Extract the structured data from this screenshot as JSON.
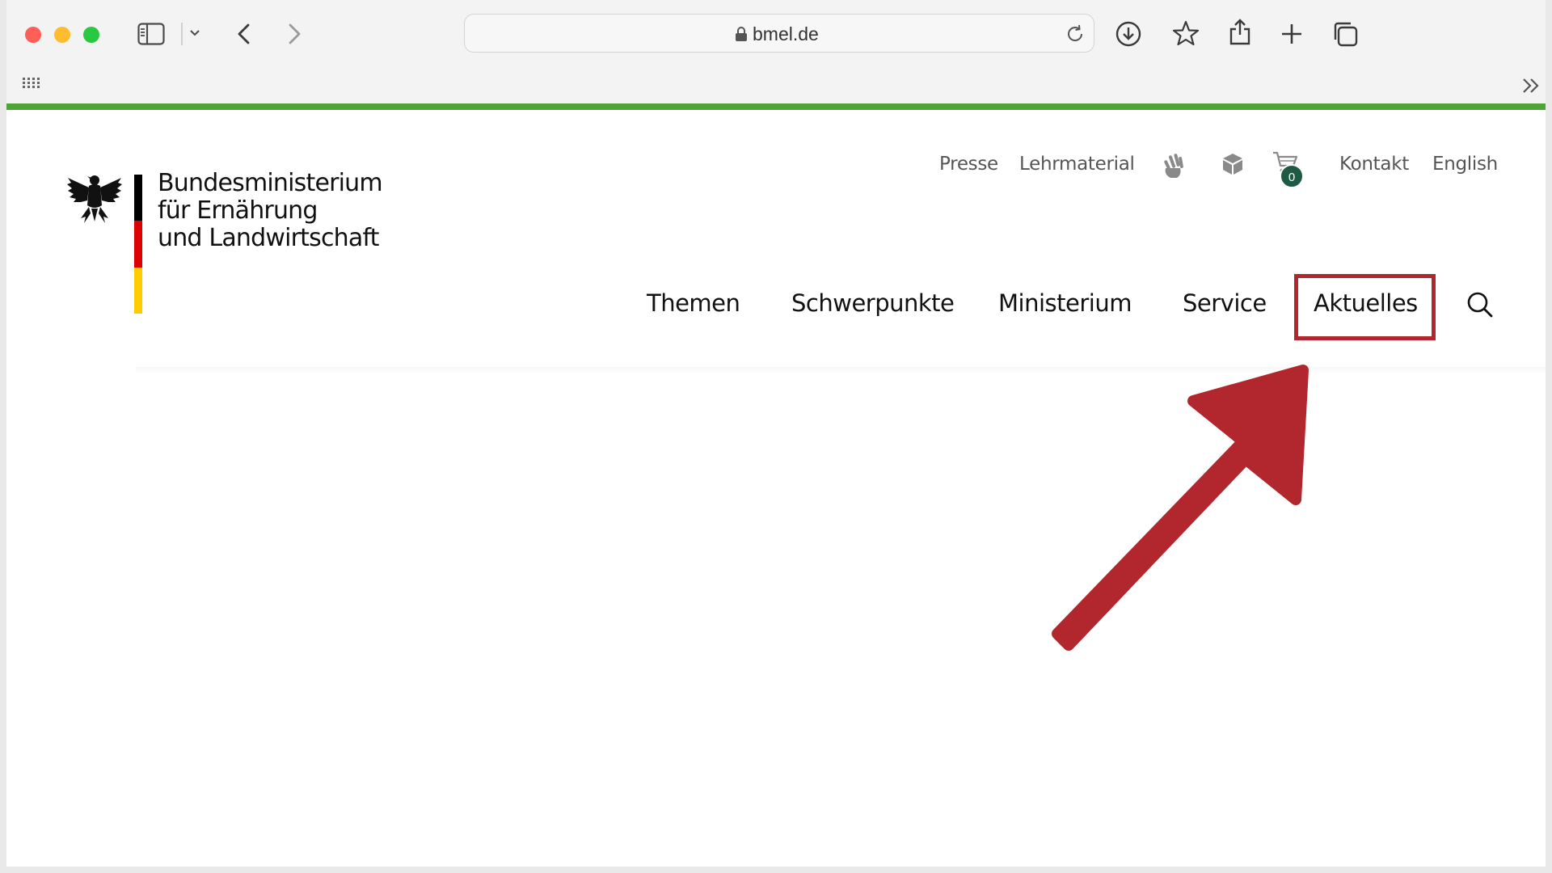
{
  "browser": {
    "url": "bmel.de",
    "icons": [
      "sidebar-icon",
      "chevron-down-icon",
      "back-icon",
      "forward-icon",
      "lock-icon",
      "reload-icon",
      "download-icon",
      "star-icon",
      "share-icon",
      "plus-icon",
      "tabs-icon",
      "grid-icon",
      "double-chevron-icon"
    ]
  },
  "site": {
    "ministry_name": {
      "line1": "Bundesministerium",
      "line2": "für Ernährung",
      "line3": "und Landwirtschaft"
    },
    "meta_nav": {
      "presse": "Presse",
      "lehrmaterial": "Lehrmaterial",
      "kontakt": "Kontakt",
      "english": "English",
      "cart_count": "0"
    },
    "main_nav": {
      "themen": "Themen",
      "schwerpunkte": "Schwerpunkte",
      "ministerium": "Ministerium",
      "service": "Service",
      "aktuelles": "Aktuelles"
    }
  },
  "annotation": {
    "highlight_color": "#b2262e",
    "accent_green": "#4fa436"
  }
}
